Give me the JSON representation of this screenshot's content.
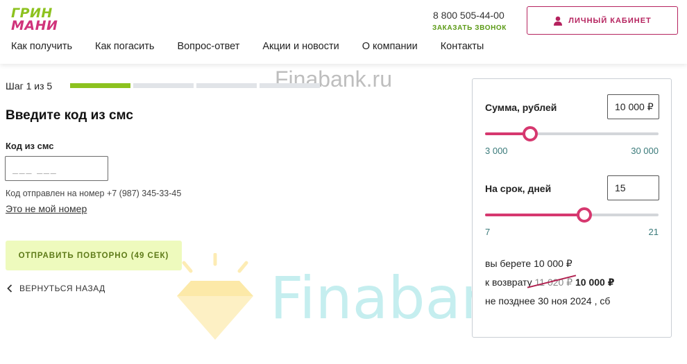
{
  "header": {
    "logo_line1": "ГРИН",
    "logo_line2": "МАНИ",
    "phone": "8 800 505-44-00",
    "callback": "ЗАКАЗАТЬ ЗВОНОК",
    "cabinet_label": "ЛИЧНЫЙ КАБИНЕТ",
    "nav": [
      "Как получить",
      "Как погасить",
      "Вопрос-ответ",
      "Акции и новости",
      "О компании",
      "Контакты"
    ]
  },
  "steps": {
    "label": "Шаг 1 из 5",
    "current": 1,
    "total": 5
  },
  "form": {
    "title": "Введите код из смс",
    "code_label": "Код из смс",
    "code_placeholder": "___ ___",
    "sent_to": "Код отправлен на номер +7 (987) 345-33-45",
    "not_mine": "Это не мой номер",
    "resend": "ОТПРАВИТЬ ПОВТОРНО (49 СЕК)",
    "back": "ВЕРНУТЬСЯ НАЗАД"
  },
  "watermark": {
    "top": "Finabank.ru",
    "big": "Finabank"
  },
  "calculator": {
    "sum_label": "Сумма, рублей",
    "sum_value": "10 000 ₽",
    "sum_min": "3 000",
    "sum_max": "30 000",
    "sum_level": 0.26,
    "term_label": "На срок, дней",
    "term_value": "15",
    "term_min": "7",
    "term_max": "21",
    "term_level": 0.57,
    "take": "вы берете 10 000 ₽",
    "return_prefix": "к возврату",
    "return_old": "11 020 ₽",
    "return_new": "10 000 ₽",
    "deadline": "не позднее 30 ноя 2024 , сб"
  },
  "colors": {
    "brand_green": "#8cc21f",
    "brand_pink": "#d6386f",
    "cabinet_border": "#b5225e"
  }
}
